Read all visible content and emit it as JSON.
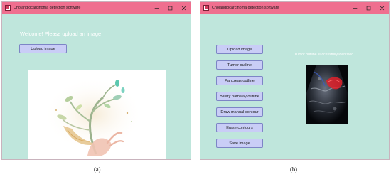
{
  "window_a": {
    "title": "Cholangiocarcinoma detection software",
    "welcome_text": "Welcome! Please upload an image",
    "upload_label": "Upload image",
    "caption": "(a)"
  },
  "window_b": {
    "title": "Cholangiocarcinoma detection software",
    "buttons": [
      "Upload image",
      "Tumor outline",
      "Pancreas outline",
      "Biliary pathway outline",
      "Draw manual contour",
      "Erase contours",
      "Save image"
    ],
    "status_text": "Tumor outline successfully identified",
    "caption": "(b)"
  },
  "colors": {
    "titlebar": "#ef6f8f",
    "window_bg": "#bfe6dc",
    "button_bg": "#c9cdf6",
    "button_border": "#7d85c6",
    "tumor_overlay": "#e0212a"
  },
  "icons": {
    "app": "app-icon",
    "minimize": "minimize-icon",
    "maximize": "maximize-icon",
    "close": "close-icon"
  }
}
